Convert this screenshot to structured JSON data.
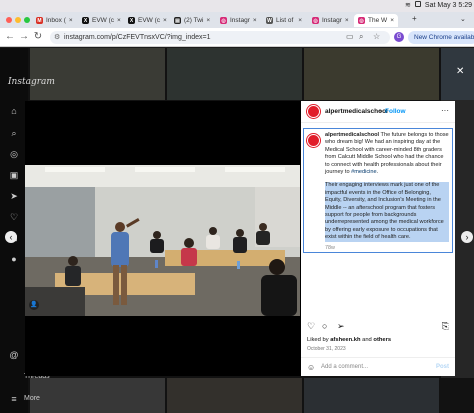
{
  "menubar": {
    "status": "Sat May 3  5:29"
  },
  "tabs": [
    {
      "label": "Inbox (",
      "favicon": "gmail-icon",
      "color": "#d93025",
      "glyph": "M"
    },
    {
      "label": "EVW (c",
      "favicon": "x-icon",
      "color": "#111111",
      "glyph": "X"
    },
    {
      "label": "EVW (c",
      "favicon": "x-icon",
      "color": "#111111",
      "glyph": "X"
    },
    {
      "label": "(2) Twi",
      "favicon": "twitch-icon",
      "color": "#222222",
      "glyph": "▤"
    },
    {
      "label": "Instagr",
      "favicon": "instagram-icon",
      "color": "#d62976",
      "glyph": "◎"
    },
    {
      "label": "List of",
      "favicon": "wikipedia-icon",
      "color": "#555555",
      "glyph": "W"
    },
    {
      "label": "Instagr",
      "favicon": "instagram-icon",
      "color": "#d62976",
      "glyph": "◎"
    },
    {
      "label": "The W",
      "favicon": "instagram-icon",
      "color": "#d62976",
      "glyph": "◎"
    }
  ],
  "address": {
    "url": "instagram.com/p/CzFEVTnsxVC/?img_index=1",
    "new_chrome": "New Chrome available",
    "profile_initial": "G"
  },
  "sidebar": {
    "logo": "Instagram",
    "threads_label": "Threads",
    "more_label": "More"
  },
  "post": {
    "username": "alpertmedicalschool",
    "follow_separator": "•",
    "follow_label": "Follow",
    "caption_user": "alpertmedicalschool",
    "caption_text_1": " The future belongs to those who dream big! We had an inspiring day at the Medical School with career-minded 8th graders from Calcutt Middle School who had the chance to connect with health professionals about their journey to ",
    "hashtag": "#medicine",
    "caption_text_1_end": ".",
    "caption_text_2": "Their engaging interviews mark just one of the impactful events in the Office of Belonging, Equity, Diversity, and Inclusion's Meeting in the Middle -- an afterschool program that fosters support for people from backgrounds underrepresented among the medical workforce by offering early exposure to occupations that exist within the field of health care.",
    "caption_age": "78w",
    "liked_by_prefix": "Liked by ",
    "liked_by_user": "afsheen.kh",
    "liked_by_and": " and ",
    "liked_by_others": "others",
    "date": "October 31, 2023",
    "comment_placeholder": "Add a comment...",
    "post_label": "Post"
  },
  "colors": {
    "instagram_avatar": "#e11d2a",
    "follow_blue": "#0095f6",
    "selection": "#b9d3f2"
  }
}
